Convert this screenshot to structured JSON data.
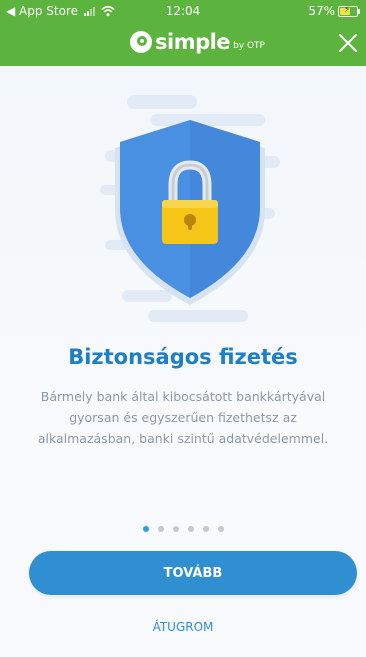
{
  "status_bar": {
    "back_label": "◀ App Store",
    "time": "12:04",
    "battery": "57%"
  },
  "header": {
    "brand_name": "simple",
    "brand_suffix": "by OTP",
    "close_icon": "close-icon",
    "background_color": "#5cb33e"
  },
  "illustration": {
    "icon": "shield-lock-icon",
    "shield_color": "#4a90e2",
    "lock_color": "#f5c518"
  },
  "content": {
    "title": "Biztonságos fizetés",
    "description": "Bármely bank által kibocsátott bankkártyával gyorsan és egyszerűen fizethetsz az alkalmazásban, banki szintű adatvédelemmel."
  },
  "pager": {
    "total": 6,
    "current": 1
  },
  "actions": {
    "next_label": "TOVÁBB",
    "skip_label": "ÁTUGROM"
  }
}
